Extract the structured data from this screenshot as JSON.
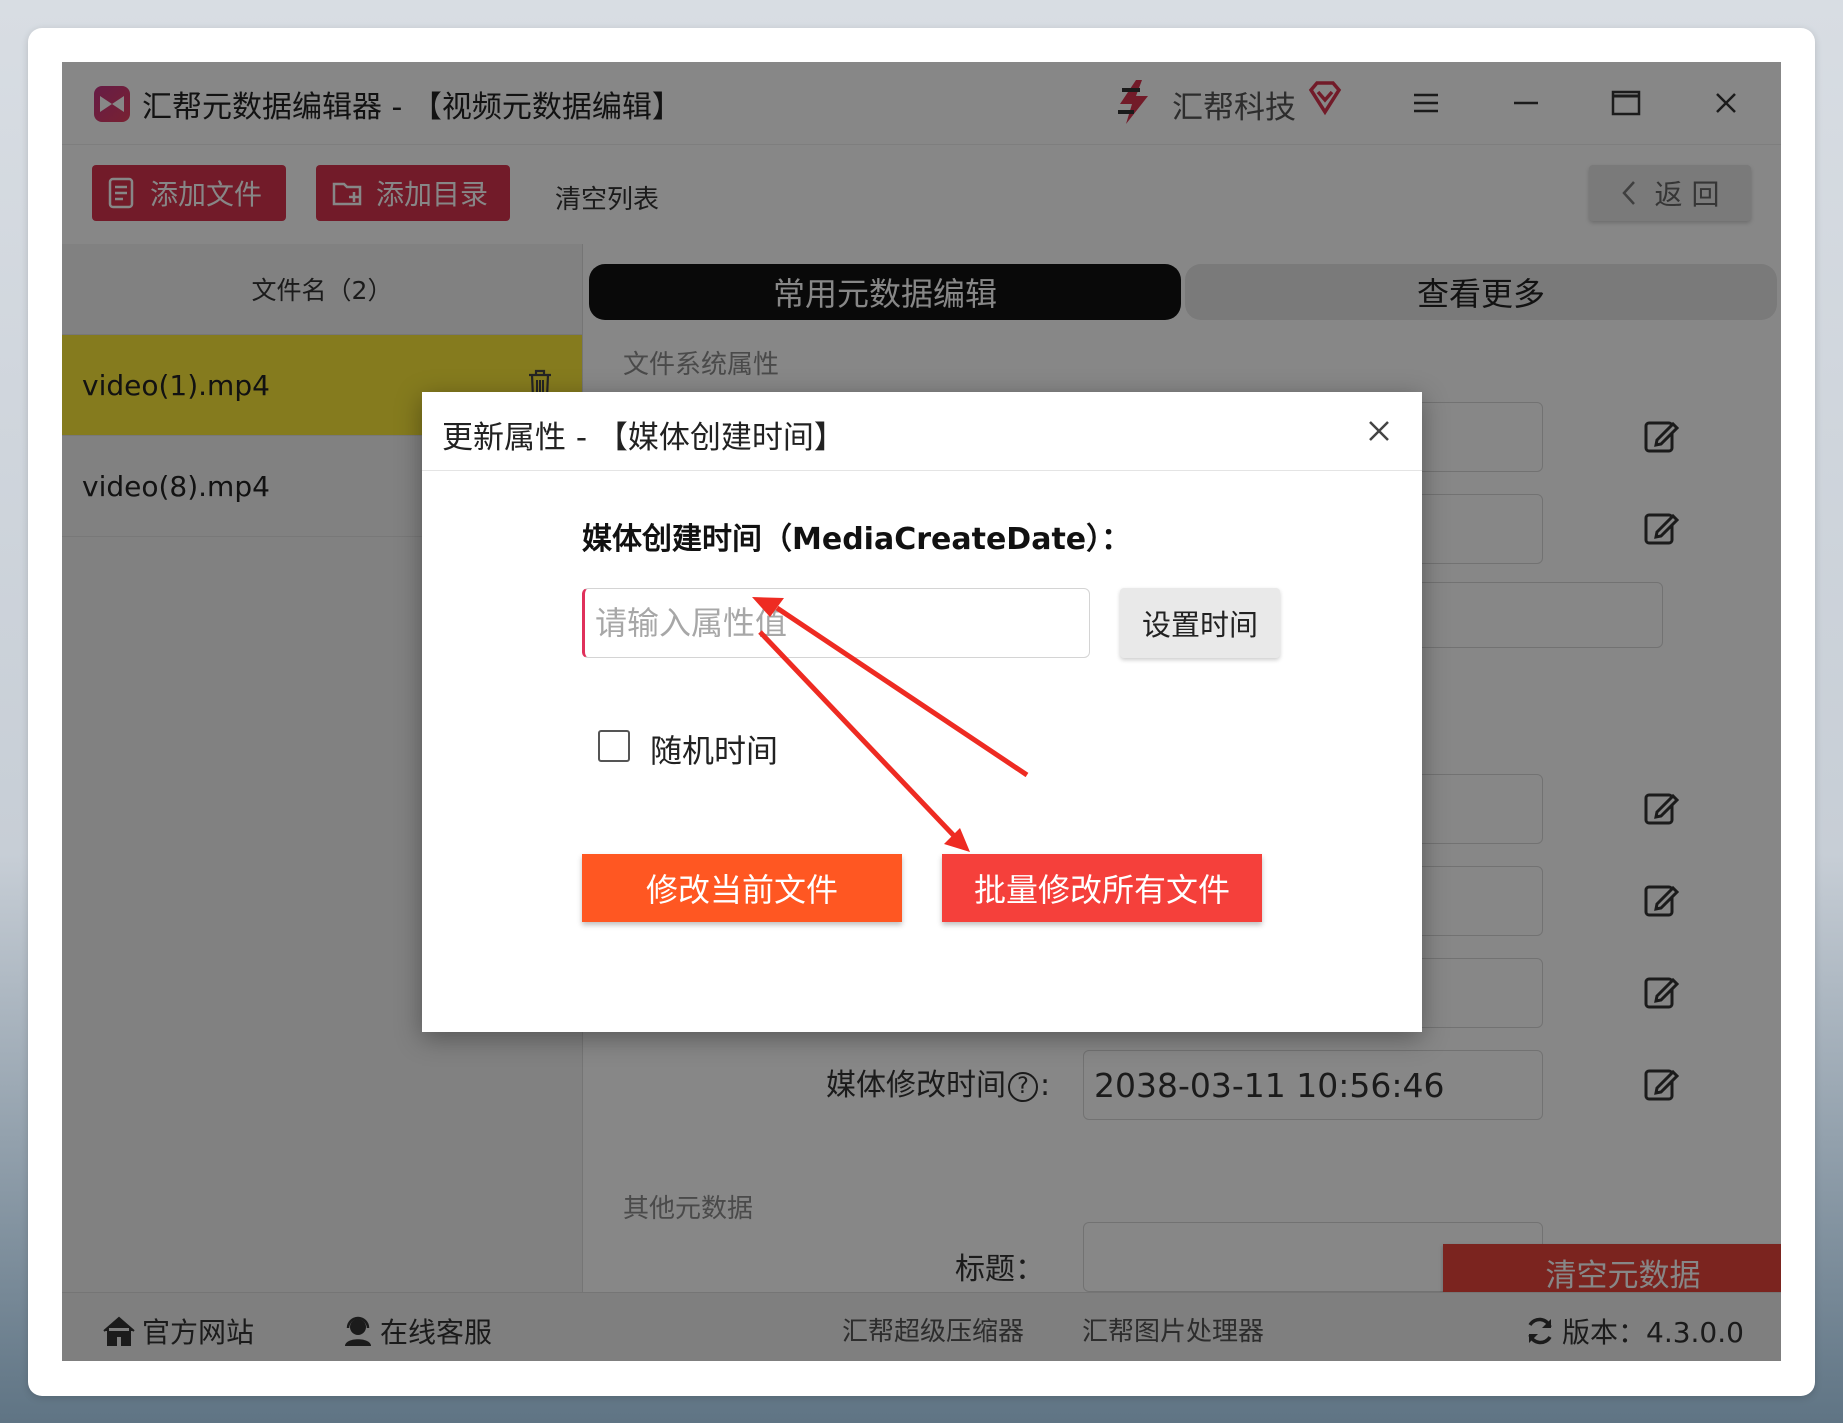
{
  "window": {
    "title": "汇帮元数据编辑器 - 【视频元数据编辑】",
    "brand": "汇帮科技"
  },
  "toolbar": {
    "add_file": "添加文件",
    "add_dir": "添加目录",
    "clear_list": "清空列表",
    "back": "返 回"
  },
  "file_list": {
    "header": "文件名（2）",
    "files": [
      {
        "name": "video(1).mp4",
        "selected": true
      },
      {
        "name": "video(8).mp4",
        "selected": false
      }
    ]
  },
  "tabs": {
    "common": "常用元数据编辑",
    "more": "查看更多"
  },
  "sections": {
    "filesystem": "文件系统属性",
    "other": "其他元数据"
  },
  "fields": {
    "media_modify_label": "媒体修改时间",
    "media_modify_value": "2038-03-11 10:56:46",
    "title_label": "标题："
  },
  "clear_metadata": "清空元数据",
  "footer": {
    "website": "官方网站",
    "support": "在线客服",
    "compressor": "汇帮超级压缩器",
    "image_tool": "汇帮图片处理器",
    "version": "版本：4.3.0.0"
  },
  "dialog": {
    "title": "更新属性 - 【媒体创建时间】",
    "field_label": "媒体创建时间（MediaCreateDate）：",
    "input_placeholder": "请输入属性值",
    "input_value": "",
    "set_time": "设置时间",
    "random_time": "随机时间",
    "random_checked": false,
    "modify_current": "修改当前文件",
    "modify_all": "批量修改所有文件"
  },
  "colors": {
    "accent_red": "#d8344f",
    "selected_row": "#fce93a",
    "btn_orange": "#ff5722",
    "btn_red": "#f5403b",
    "annotation_arrow": "#ee2b22"
  }
}
